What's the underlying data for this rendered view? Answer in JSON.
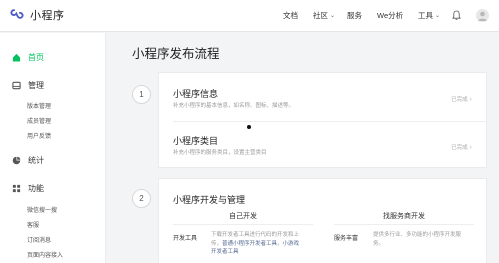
{
  "header": {
    "logo_text": "小程序",
    "nav": [
      {
        "label": "文档",
        "dropdown": false
      },
      {
        "label": "社区",
        "dropdown": true
      },
      {
        "label": "服务",
        "dropdown": false
      },
      {
        "label": "We分析",
        "dropdown": false
      },
      {
        "label": "工具",
        "dropdown": true
      }
    ],
    "bell_icon": "bell-icon",
    "user_icon": "user-icon"
  },
  "sidebar": {
    "home": "首页",
    "manage": "管理",
    "manage_items": [
      "版本管理",
      "成员管理",
      "用户反馈"
    ],
    "stats": "统计",
    "features": "功能",
    "feature_items": [
      "微信搜一搜",
      "客服",
      "订阅消息",
      "页面内容接入"
    ]
  },
  "main": {
    "title": "小程序发布流程",
    "step1": {
      "number": "1",
      "rows": [
        {
          "title": "小程序信息",
          "desc": "补充小程序的基本信息，如名称、图标、描述等。",
          "status": "已完成"
        },
        {
          "title": "小程序类目",
          "desc": "补充小程序的服务类目，设置主营类目",
          "status": "已完成"
        }
      ]
    },
    "step2": {
      "number": "2",
      "title": "小程序开发与管理",
      "col_left_title": "自己开发",
      "col_right_title": "找服务商开发",
      "left_item_label": "开发工具",
      "left_item_desc_1": "下载开发者工具进行代码的开发和上",
      "left_item_desc_2a": "传，",
      "left_item_link_1": "普通小程序开发者工具",
      "left_item_desc_2b": "，",
      "left_item_link_2": "小游戏",
      "left_item_link_3": "开发者工具",
      "right_item_label": "服务丰富",
      "right_item_desc_1": "提供多行业、多功能的小程序开发服",
      "right_item_desc_2": "务。"
    }
  },
  "colors": {
    "accent": "#07c160",
    "link": "#576b95"
  }
}
